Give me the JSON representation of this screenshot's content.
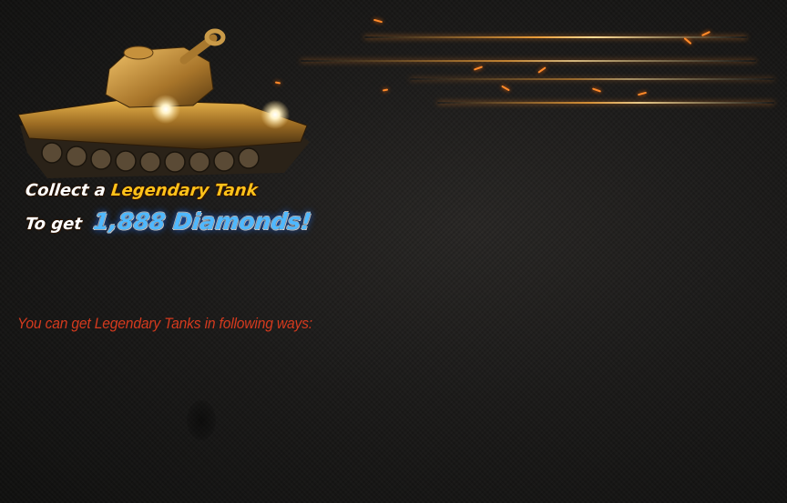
{
  "promo": {
    "line1_lead": "Collect a",
    "line1_highlight": "Legendary Tank",
    "line2_lead": "To get",
    "line2_highlight": "1,888 Diamonds!"
  },
  "info": {
    "ways_text": "You can get Legendary Tanks in following ways:"
  },
  "colors": {
    "gold": "#ffc21a",
    "diamond_blue": "#4fb8ff",
    "info_red": "#d43a1e",
    "spark_orange": "#ff8a2a"
  },
  "icons": {
    "tank": "legendary-tank-illustration"
  }
}
